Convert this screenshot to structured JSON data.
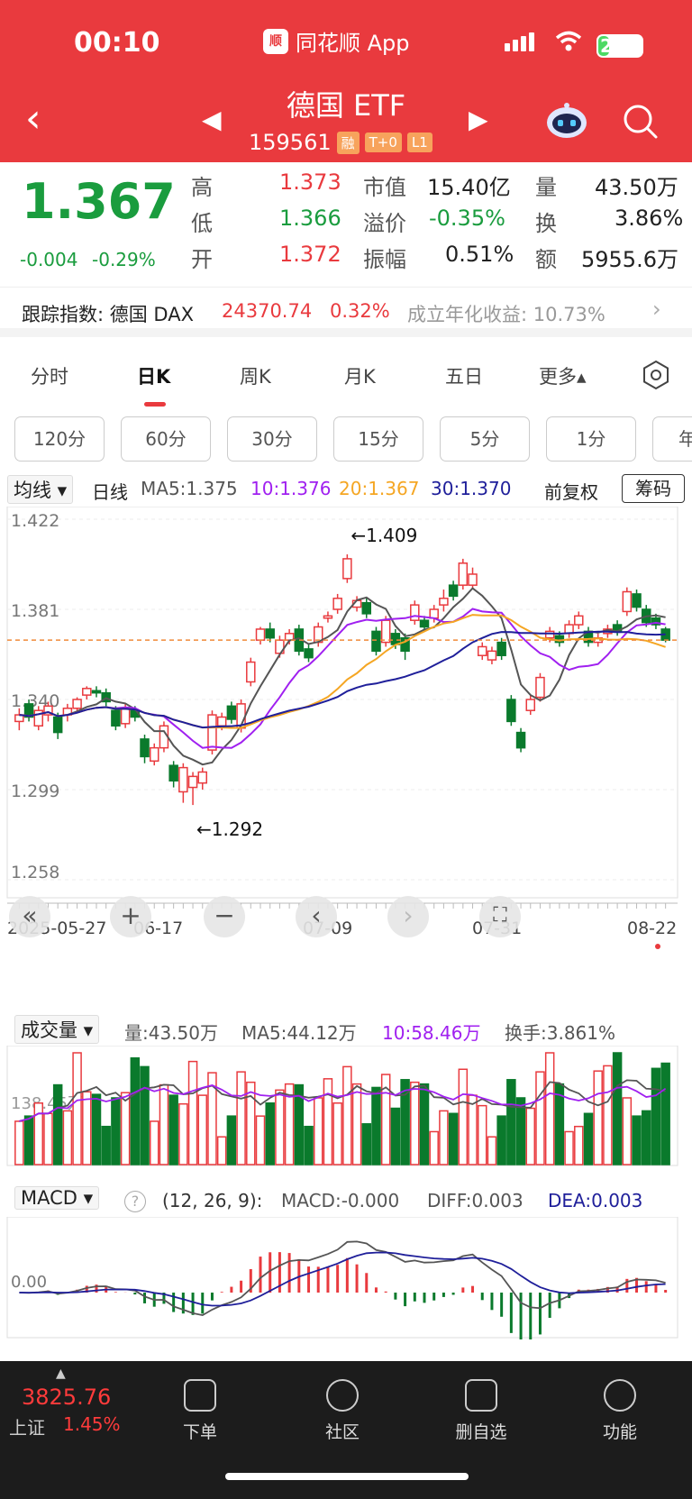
{
  "status": {
    "time": "00:10",
    "app_name": "同花顺 App",
    "battery": "25"
  },
  "header": {
    "title": "德国 ETF",
    "code": "159561",
    "tags": [
      "融",
      "T+0",
      "L1"
    ]
  },
  "quote": {
    "price": "1.367",
    "change": "-0.004",
    "change_pct": "-0.29%",
    "high_label": "高",
    "high": "1.373",
    "low_label": "低",
    "low": "1.366",
    "open_label": "开",
    "open": "1.372",
    "mktcap_label": "市值",
    "mktcap": "15.40亿",
    "premium_label": "溢价",
    "premium": "-0.35%",
    "amp_label": "振幅",
    "amp": "0.51%",
    "vol_label": "量",
    "vol": "43.50万",
    "turn_label": "换",
    "turn": "3.86%",
    "amt_label": "额",
    "amt": "5955.6万"
  },
  "tracking": {
    "label": "跟踪指数: 德国 DAX",
    "value": "24370.74",
    "pct": "0.32%",
    "annual": "成立年化收益: 10.73%"
  },
  "period_tabs": [
    "分时",
    "日K",
    "周K",
    "月K",
    "五日",
    "更多▴"
  ],
  "minute_tabs": [
    "120分",
    "60分",
    "30分",
    "15分",
    "5分",
    "1分",
    "年"
  ],
  "ma_bar": {
    "dropdown": "均线 ▾",
    "period": "日线",
    "ma5": "MA5:1.375",
    "ma10": "10:1.376",
    "ma20": "20:1.367",
    "ma30": "30:1.370",
    "adjust": "前复权",
    "chips": "筹码"
  },
  "colors": {
    "up": "#e93a3e",
    "down": "#0a7a2c",
    "ma5": "#555555",
    "ma10": "#a020f0",
    "ma20": "#f5a623",
    "ma30": "#1f1f9a"
  },
  "chart_data": {
    "type": "candlestick",
    "y_ticks": [
      "1.422",
      "1.381",
      "1.340",
      "1.299",
      "1.258"
    ],
    "ylim": [
      1.258,
      1.422
    ],
    "x_labels": [
      "2025-05-27",
      "06-17",
      "07-09",
      "07-31",
      "08-22"
    ],
    "annotations": [
      "←1.409",
      "←1.292"
    ],
    "candles": [
      [
        1.33,
        1.333,
        1.326,
        1.336
      ],
      [
        1.338,
        1.332,
        1.33,
        1.34
      ],
      [
        1.328,
        1.335,
        1.326,
        1.337
      ],
      [
        1.333,
        1.337,
        1.33,
        1.339
      ],
      [
        1.332,
        1.325,
        1.322,
        1.334
      ],
      [
        1.333,
        1.336,
        1.33,
        1.338
      ],
      [
        1.336,
        1.34,
        1.334,
        1.341
      ],
      [
        1.342,
        1.345,
        1.34,
        1.346
      ],
      [
        1.344,
        1.343,
        1.341,
        1.346
      ],
      [
        1.343,
        1.339,
        1.337,
        1.345
      ],
      [
        1.335,
        1.328,
        1.326,
        1.337
      ],
      [
        1.329,
        1.336,
        1.327,
        1.338
      ],
      [
        1.335,
        1.332,
        1.33,
        1.337
      ],
      [
        1.322,
        1.314,
        1.311,
        1.324
      ],
      [
        1.312,
        1.318,
        1.31,
        1.32
      ],
      [
        1.318,
        1.328,
        1.316,
        1.33
      ],
      [
        1.31,
        1.303,
        1.3,
        1.312
      ],
      [
        1.298,
        1.309,
        1.293,
        1.311
      ],
      [
        1.3,
        1.305,
        1.292,
        1.307
      ],
      [
        1.302,
        1.307,
        1.299,
        1.309
      ],
      [
        1.317,
        1.333,
        1.315,
        1.335
      ],
      [
        1.328,
        1.332,
        1.326,
        1.334
      ],
      [
        1.337,
        1.331,
        1.329,
        1.339
      ],
      [
        1.327,
        1.338,
        1.325,
        1.34
      ],
      [
        1.348,
        1.357,
        1.346,
        1.359
      ],
      [
        1.367,
        1.372,
        1.365,
        1.373
      ],
      [
        1.372,
        1.368,
        1.366,
        1.375
      ],
      [
        1.361,
        1.367,
        1.359,
        1.369
      ],
      [
        1.367,
        1.37,
        1.365,
        1.372
      ],
      [
        1.372,
        1.362,
        1.36,
        1.374
      ],
      [
        1.363,
        1.359,
        1.357,
        1.365
      ],
      [
        1.366,
        1.373,
        1.364,
        1.375
      ],
      [
        1.377,
        1.378,
        1.375,
        1.38
      ],
      [
        1.381,
        1.386,
        1.379,
        1.388
      ],
      [
        1.395,
        1.404,
        1.393,
        1.406
      ],
      [
        1.382,
        1.385,
        1.38,
        1.387
      ],
      [
        1.384,
        1.379,
        1.377,
        1.386
      ],
      [
        1.371,
        1.362,
        1.36,
        1.373
      ],
      [
        1.366,
        1.376,
        1.364,
        1.378
      ],
      [
        1.37,
        1.365,
        1.363,
        1.372
      ],
      [
        1.368,
        1.362,
        1.358,
        1.37
      ],
      [
        1.376,
        1.383,
        1.374,
        1.385
      ],
      [
        1.376,
        1.373,
        1.371,
        1.378
      ],
      [
        1.377,
        1.381,
        1.375,
        1.383
      ],
      [
        1.383,
        1.386,
        1.38,
        1.39
      ],
      [
        1.392,
        1.387,
        1.385,
        1.394
      ],
      [
        1.392,
        1.402,
        1.39,
        1.404
      ],
      [
        1.392,
        1.397,
        1.39,
        1.4
      ],
      [
        1.36,
        1.364,
        1.358,
        1.366
      ],
      [
        1.358,
        1.362,
        1.356,
        1.364
      ],
      [
        1.366,
        1.36,
        1.358,
        1.368
      ],
      [
        1.34,
        1.33,
        1.328,
        1.342
      ],
      [
        1.325,
        1.318,
        1.316,
        1.327
      ],
      [
        1.335,
        1.34,
        1.333,
        1.342
      ],
      [
        1.341,
        1.35,
        1.339,
        1.352
      ],
      [
        1.368,
        1.371,
        1.366,
        1.373
      ],
      [
        1.369,
        1.366,
        1.364,
        1.371
      ],
      [
        1.37,
        1.374,
        1.368,
        1.376
      ],
      [
        1.374,
        1.378,
        1.372,
        1.38
      ],
      [
        1.371,
        1.366,
        1.364,
        1.373
      ],
      [
        1.366,
        1.368,
        1.364,
        1.37
      ],
      [
        1.37,
        1.372,
        1.368,
        1.374
      ],
      [
        1.374,
        1.371,
        1.369,
        1.376
      ],
      [
        1.38,
        1.389,
        1.378,
        1.391
      ],
      [
        1.388,
        1.382,
        1.38,
        1.39
      ],
      [
        1.381,
        1.375,
        1.373,
        1.383
      ],
      [
        1.377,
        1.374,
        1.372,
        1.379
      ],
      [
        1.372,
        1.367,
        1.366,
        1.373
      ]
    ]
  },
  "volume_bar": {
    "dropdown": "成交量 ▾",
    "vol": "量:43.50万",
    "ma5": "MA5:44.12万",
    "ma10": "10:58.46万",
    "turnover": "换手:3.861%",
    "tick": "138.45万"
  },
  "macd_bar": {
    "dropdown": "MACD ▾",
    "help": "?",
    "params": "(12, 26, 9):",
    "macd": "MACD:-0.000",
    "diff": "DIFF:0.003",
    "dea": "DEA:0.003",
    "zero": "0.00"
  },
  "bottom_nav": {
    "index_value": "3825.76",
    "index_name": "上证",
    "index_pct": "1.45%",
    "items": [
      "下单",
      "社区",
      "删自选",
      "功能"
    ]
  }
}
